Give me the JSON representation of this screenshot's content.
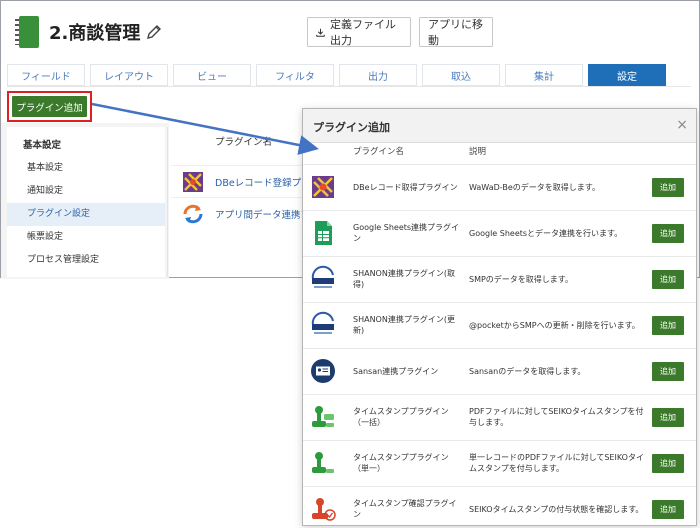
{
  "app": {
    "title": "2.商談管理"
  },
  "header": {
    "export_label": "定義ファイル出力",
    "move_label": "アプリに移動"
  },
  "tabs": [
    "フィールド",
    "レイアウト",
    "ビュー",
    "フィルタ",
    "出力",
    "取込",
    "集計",
    "設定"
  ],
  "active_tab": "設定",
  "add_plugin_label": "プラグイン追加",
  "sidebar": {
    "heading": "基本設定",
    "items": [
      "基本設定",
      "通知設定",
      "プラグイン設定",
      "帳票設定",
      "プロセス管理設定"
    ],
    "active": "プラグイン設定"
  },
  "list": {
    "column_name": "プラグイン名",
    "rows": [
      "DBeレコード登録プラグイン",
      "アプリ間データ連携プラグイン"
    ]
  },
  "dialog": {
    "title": "プラグイン追加",
    "close": "×",
    "col_name": "プラグイン名",
    "col_desc": "説明",
    "add_label": "追加",
    "rows": [
      {
        "name": "DBeレコード取得プラグイン",
        "desc": "WaWaD-Beのデータを取得します。",
        "icon": "dbe-icon"
      },
      {
        "name": "Google Sheets連携プラグイン",
        "desc": "Google Sheetsとデータ連携を行います。",
        "icon": "sheets-icon"
      },
      {
        "name": "SHANON連携プラグイン(取得)",
        "desc": "SMPのデータを取得します。",
        "icon": "shanon-icon"
      },
      {
        "name": "SHANON連携プラグイン(更新)",
        "desc": "@pocketからSMPへの更新・削除を行います。",
        "icon": "shanon-icon"
      },
      {
        "name": "Sansan連携プラグイン",
        "desc": "Sansanのデータを取得します。",
        "icon": "sansan-icon"
      },
      {
        "name": "タイムスタンププラグイン（一括）",
        "desc": "PDFファイルに対してSEIKOタイムスタンプを付与します。",
        "icon": "timestamp-icon"
      },
      {
        "name": "タイムスタンププラグイン（単一）",
        "desc": "単一レコードのPDFファイルに対してSEIKOタイムスタンプを付与します。",
        "icon": "timestamp-icon"
      },
      {
        "name": "タイムスタンプ確認プラグイン",
        "desc": "SEIKOタイムスタンプの付与状態を確認します。",
        "icon": "timestamp-check-icon"
      }
    ]
  },
  "colors": {
    "accent_green": "#3b7a2a",
    "tab_active": "#1f6fb8",
    "link_blue": "#2a62a8",
    "highlight_red": "#e02020"
  }
}
